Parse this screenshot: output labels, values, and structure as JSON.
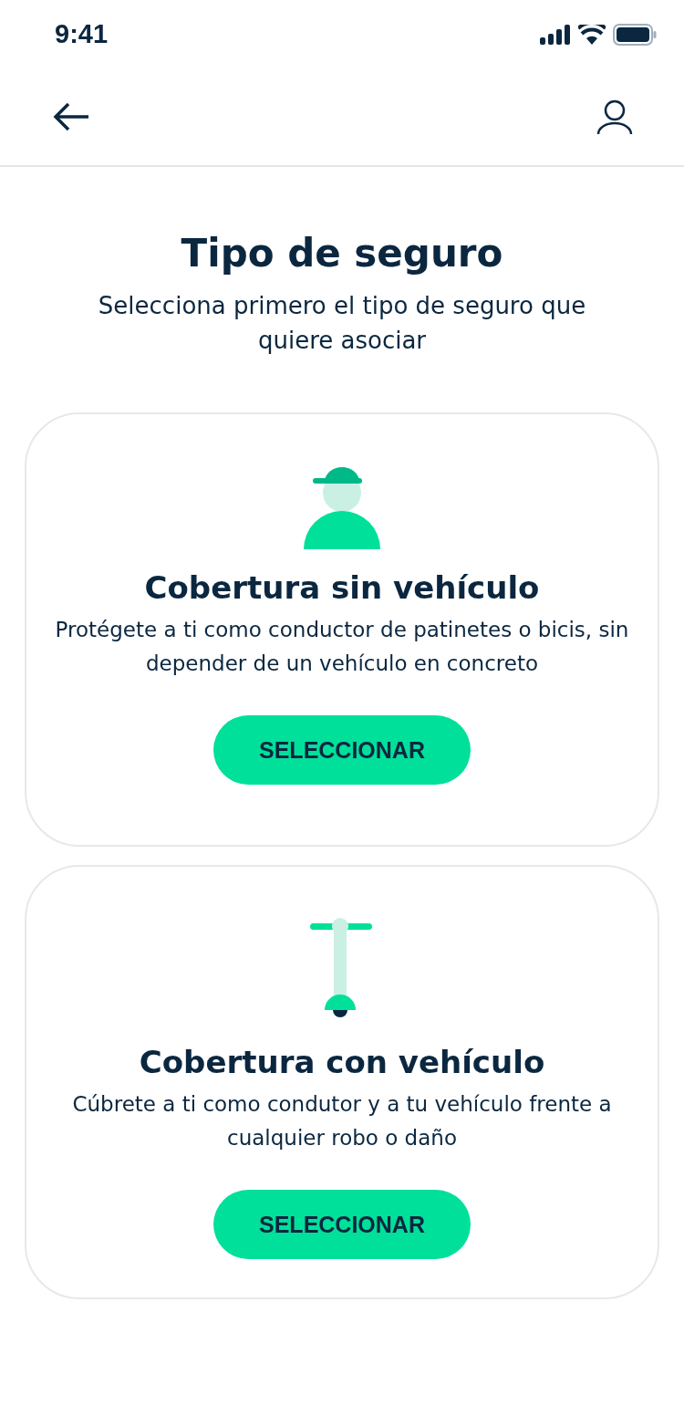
{
  "status_bar": {
    "time": "9:41"
  },
  "title": "Tipo de seguro",
  "subtitle": "Selecciona primero el tipo de seguro que quiere asociar",
  "options": [
    {
      "kind": "person",
      "title": "Cobertura sin vehículo",
      "description": "Protégete a ti como conductor de patinetes o bicis, sin depender de un vehículo en concreto",
      "button": "SELECCIONAR"
    },
    {
      "kind": "scooter",
      "title": "Cobertura con vehículo",
      "description": "Cúbrete a ti como condutor y a tu vehículo frente a cualquier robo o daño",
      "button": "SELECCIONAR"
    }
  ]
}
